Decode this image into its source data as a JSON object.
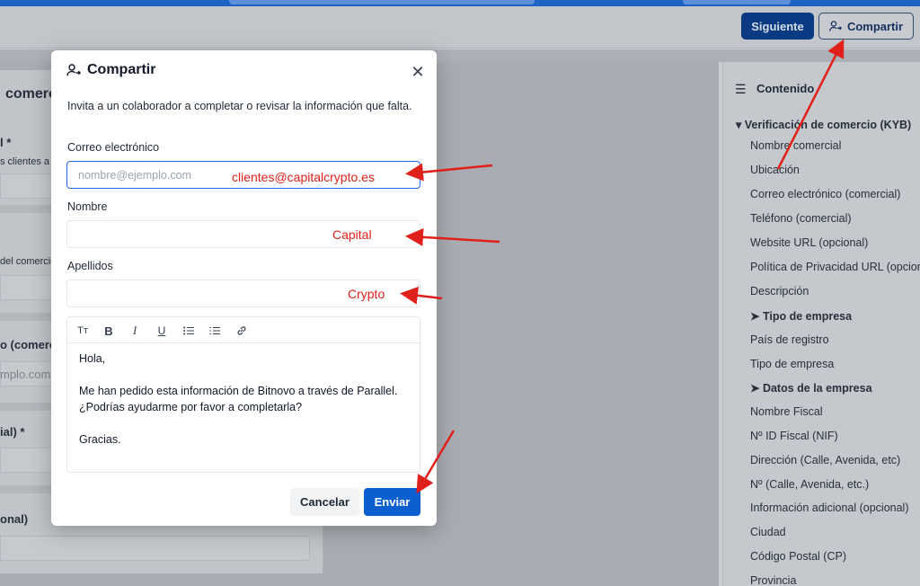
{
  "header": {
    "next_label": "Siguiente",
    "share_label": "Compartir"
  },
  "background": {
    "section_title": "comerc",
    "field1_label": "l *",
    "field1_help": "s clientes a",
    "field2_help": "del comercio",
    "field3_label": "o (comerc",
    "field3_placeholder": "mplo.com",
    "field4_label": "ial) *",
    "field5_label": "onal)"
  },
  "sidebar": {
    "title": "Contenido",
    "section": "Verificación de comercio (KYB)",
    "items": [
      "Nombre comercial",
      "Ubicación",
      "Correo electrónico (comercial)",
      "Teléfono (comercial)",
      "Website URL (opcional)",
      "Política de Privacidad URL (opcion"
    ],
    "item_descripcion": "Descripción",
    "group1": "➤ Tipo de empresa",
    "group1_items": [
      "País de registro",
      "Tipo de empresa"
    ],
    "group2": "➤ Datos de la empresa",
    "group2_items": [
      "Nombre Fiscal",
      "Nº ID Fiscal (NIF)",
      "Dirección (Calle, Avenida, etc)",
      "Nº (Calle, Avenida, etc.)",
      "Información adicional (opcional)",
      "Ciudad",
      "Código Postal (CP)",
      "Provincia"
    ]
  },
  "modal": {
    "title": "Compartir",
    "description": "Invita a un colaborador a completar o revisar la información que falta.",
    "email_label": "Correo electrónico",
    "email_placeholder": "nombre@ejemplo.com",
    "email_value": "",
    "name_label": "Nombre",
    "name_value": "",
    "lastname_label": "Apellidos",
    "lastname_value": "",
    "toolbar_text_icon": "Tт",
    "toolbar_bold": "B",
    "toolbar_italic": "I",
    "toolbar_underline": "U",
    "message": {
      "greeting": "Hola,",
      "line1": "Me han pedido esta información de Bitnovo a través de Parallel.",
      "line2": "¿Podrías ayudarme por favor a completarla?",
      "closing": "Gracias."
    },
    "cancel_label": "Cancelar",
    "send_label": "Enviar"
  },
  "annotations": {
    "email": "clientes@capitalcrypto.es",
    "name": "Capital",
    "lastname": "Crypto",
    "color": "#e0201a"
  }
}
